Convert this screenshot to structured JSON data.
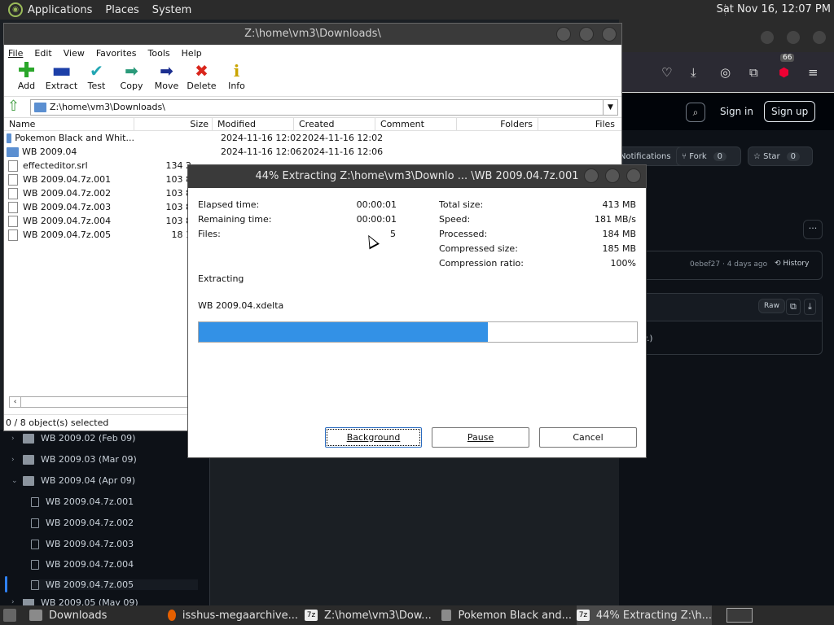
{
  "top_panel": {
    "menus": [
      "Applications",
      "Places",
      "System"
    ],
    "clock": "Sat Nov 16, 12:07 PM"
  },
  "browser": {
    "badge": "66",
    "signin": "Sign in",
    "signup": "Sign up",
    "notifications": "Notifications",
    "fork_label": "Fork",
    "fork_count": "0",
    "star_label": "Star",
    "star_count": "0",
    "commit": "0ebef27 · 4 days ago",
    "history": "History",
    "raw": "Raw",
    "snippet": "w.)"
  },
  "tree": {
    "items": [
      {
        "label": "WB 2009.02 (Feb 09)",
        "type": "folder"
      },
      {
        "label": "WB 2009.03 (Mar 09)",
        "type": "folder"
      },
      {
        "label": "WB 2009.04 (Apr 09)",
        "type": "folder-open"
      },
      {
        "label": "WB 2009.04.7z.001",
        "type": "file"
      },
      {
        "label": "WB 2009.04.7z.002",
        "type": "file"
      },
      {
        "label": "WB 2009.04.7z.003",
        "type": "file"
      },
      {
        "label": "WB 2009.04.7z.004",
        "type": "file"
      },
      {
        "label": "WB 2009.04.7z.005",
        "type": "file"
      },
      {
        "label": "WB 2009.05 (May 09)",
        "type": "folder"
      }
    ]
  },
  "zip": {
    "title": "Z:\\home\\vm3\\Downloads\\",
    "menu": [
      "File",
      "Edit",
      "View",
      "Favorites",
      "Tools",
      "Help"
    ],
    "toolbar": [
      "Add",
      "Extract",
      "Test",
      "Copy",
      "Move",
      "Delete",
      "Info"
    ],
    "path": "Z:\\home\\vm3\\Downloads\\",
    "columns": [
      "Name",
      "Size",
      "Modified",
      "Created",
      "Comment",
      "Folders",
      "Files"
    ],
    "rows": [
      {
        "name": "Pokemon Black and Whit...",
        "size": "",
        "modified": "2024-11-16 12:02",
        "created": "2024-11-16 12:02",
        "type": "folder"
      },
      {
        "name": "WB 2009.04",
        "size": "",
        "modified": "2024-11-16 12:06",
        "created": "2024-11-16 12:06",
        "type": "folder"
      },
      {
        "name": "effecteditor.srl",
        "size": "134 2",
        "modified": "",
        "created": "",
        "type": "file"
      },
      {
        "name": "WB 2009.04.7z.001",
        "size": "103 8",
        "modified": "",
        "created": "",
        "type": "file"
      },
      {
        "name": "WB 2009.04.7z.002",
        "size": "103 8",
        "modified": "",
        "created": "",
        "type": "file"
      },
      {
        "name": "WB 2009.04.7z.003",
        "size": "103 8",
        "modified": "",
        "created": "",
        "type": "file"
      },
      {
        "name": "WB 2009.04.7z.004",
        "size": "103 8",
        "modified": "",
        "created": "",
        "type": "file"
      },
      {
        "name": "WB 2009.04.7z.005",
        "size": "18 1",
        "modified": "",
        "created": "",
        "type": "file"
      }
    ],
    "status": "0 / 8 object(s) selected"
  },
  "dialog": {
    "title": "44% Extracting Z:\\home\\vm3\\Downlo ... \\WB 2009.04.7z.001",
    "elapsed_label": "Elapsed time:",
    "elapsed": "00:00:01",
    "remaining_label": "Remaining time:",
    "remaining": "00:00:01",
    "files_label": "Files:",
    "files": "5",
    "total_label": "Total size:",
    "total": "413 MB",
    "speed_label": "Speed:",
    "speed": "181 MB/s",
    "processed_label": "Processed:",
    "processed": "184 MB",
    "compressed_label": "Compressed size:",
    "compressed": "185 MB",
    "ratio_label": "Compression ratio:",
    "ratio": "100%",
    "state": "Extracting",
    "current_file": "WB 2009.04.xdelta",
    "progress": 0.66,
    "btn_background": "Background",
    "btn_pause": "Pause",
    "btn_cancel": "Cancel"
  },
  "taskbar": {
    "items": [
      "Downloads",
      "isshus-megaarchive...",
      "Z:\\home\\vm3\\Dow...",
      "Pokemon Black and...",
      "44% Extracting Z:\\h..."
    ]
  }
}
